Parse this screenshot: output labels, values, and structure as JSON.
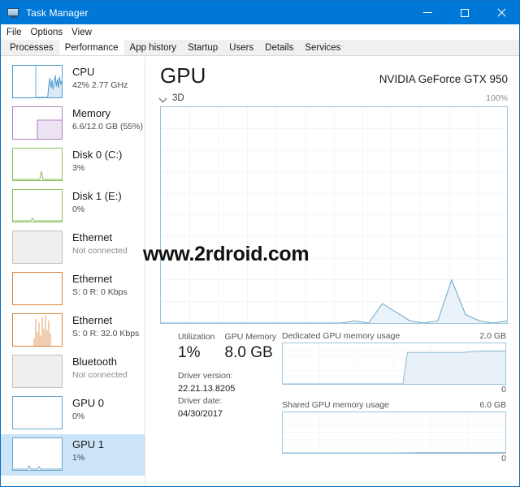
{
  "window": {
    "title": "Task Manager",
    "icon": "task-manager-icon",
    "accent": "#0078d7",
    "buttons": {
      "minimize": "–",
      "maximize": "☐",
      "close": "✕"
    }
  },
  "menubar": {
    "items": [
      {
        "label": "File"
      },
      {
        "label": "Options"
      },
      {
        "label": "View"
      }
    ]
  },
  "tabs": {
    "active": "Performance",
    "items": [
      {
        "label": "Processes"
      },
      {
        "label": "Performance"
      },
      {
        "label": "App history"
      },
      {
        "label": "Startup"
      },
      {
        "label": "Users"
      },
      {
        "label": "Details"
      },
      {
        "label": "Services"
      }
    ]
  },
  "sidebar": {
    "items": [
      {
        "name": "CPU",
        "detail": "42% 2.77 GHz",
        "color": "#4e9ccc",
        "selected": false,
        "dim": false
      },
      {
        "name": "Memory",
        "detail": "6.6/12.0 GB (55%)",
        "color": "#b37fc0",
        "selected": false,
        "dim": false
      },
      {
        "name": "Disk 0 (C:)",
        "detail": "3%",
        "color": "#8bbf5c",
        "selected": false,
        "dim": false
      },
      {
        "name": "Disk 1 (E:)",
        "detail": "0%",
        "color": "#8bbf5c",
        "selected": false,
        "dim": false
      },
      {
        "name": "Ethernet",
        "detail": "Not connected",
        "color": "#c0c0c0",
        "selected": false,
        "dim": true
      },
      {
        "name": "Ethernet",
        "detail": "S: 0 R: 0 Kbps",
        "color": "#d9843b",
        "selected": false,
        "dim": false
      },
      {
        "name": "Ethernet",
        "detail": "S: 0 R: 32.0 Kbps",
        "color": "#d9843b",
        "selected": false,
        "dim": false
      },
      {
        "name": "Bluetooth",
        "detail": "Not connected",
        "color": "#c0c0c0",
        "selected": false,
        "dim": true
      },
      {
        "name": "GPU 0",
        "detail": "0%",
        "color": "#6aa7d0",
        "selected": false,
        "dim": false
      },
      {
        "name": "GPU 1",
        "detail": "1%",
        "color": "#6aa7d0",
        "selected": true,
        "dim": false
      }
    ]
  },
  "main": {
    "title": "GPU",
    "device": "NVIDIA GeForce GTX 950",
    "engine_label": "3D",
    "engine_max": "100%",
    "stats": {
      "utilization_label": "Utilization",
      "utilization_value": "1%",
      "gpu_memory_label": "GPU Memory",
      "gpu_memory_value": "8.0 GB",
      "driver_version_label": "Driver version:",
      "driver_version_value": "22.21.13.8205",
      "driver_date_label": "Driver date:",
      "driver_date_value": "04/30/2017"
    },
    "dedicated": {
      "label": "Dedicated GPU memory usage",
      "max": "2.0 GB",
      "min": "0"
    },
    "shared": {
      "label": "Shared GPU memory usage",
      "max": "6.0 GB",
      "min": "0"
    }
  },
  "watermark": {
    "text": "www.2rdroid.com"
  },
  "chart_data": [
    {
      "type": "area",
      "title": "3D",
      "ylabel": "",
      "xlabel": "",
      "ylim": [
        0,
        100
      ],
      "units": "%",
      "grid": true,
      "legend": "none",
      "x": [
        0,
        4,
        8,
        12,
        16,
        20,
        24,
        28,
        32,
        36,
        40,
        44,
        48,
        52,
        56,
        60,
        64,
        68,
        72,
        76,
        80,
        84,
        88,
        92,
        96,
        100
      ],
      "values": [
        0,
        0,
        0,
        0,
        0,
        0,
        0,
        0,
        0,
        0,
        0,
        0,
        0,
        0,
        1,
        0,
        9,
        5,
        1,
        0,
        1,
        20,
        4,
        1,
        0,
        1
      ]
    },
    {
      "type": "area",
      "title": "Dedicated GPU memory usage",
      "ylim": [
        0,
        2.0
      ],
      "units": "GB",
      "grid": true,
      "legend": "none",
      "x": [
        0,
        10,
        20,
        30,
        40,
        50,
        54,
        56,
        60,
        70,
        80,
        90,
        100
      ],
      "values": [
        0,
        0,
        0,
        0,
        0,
        0,
        0,
        1.55,
        1.55,
        1.55,
        1.55,
        1.62,
        1.62
      ]
    },
    {
      "type": "area",
      "title": "Shared GPU memory usage",
      "ylim": [
        0,
        6.0
      ],
      "units": "GB",
      "grid": true,
      "legend": "none",
      "x": [
        0,
        20,
        40,
        50,
        60,
        80,
        100
      ],
      "values": [
        0,
        0,
        0,
        0,
        0.04,
        0.04,
        0.04
      ]
    }
  ]
}
